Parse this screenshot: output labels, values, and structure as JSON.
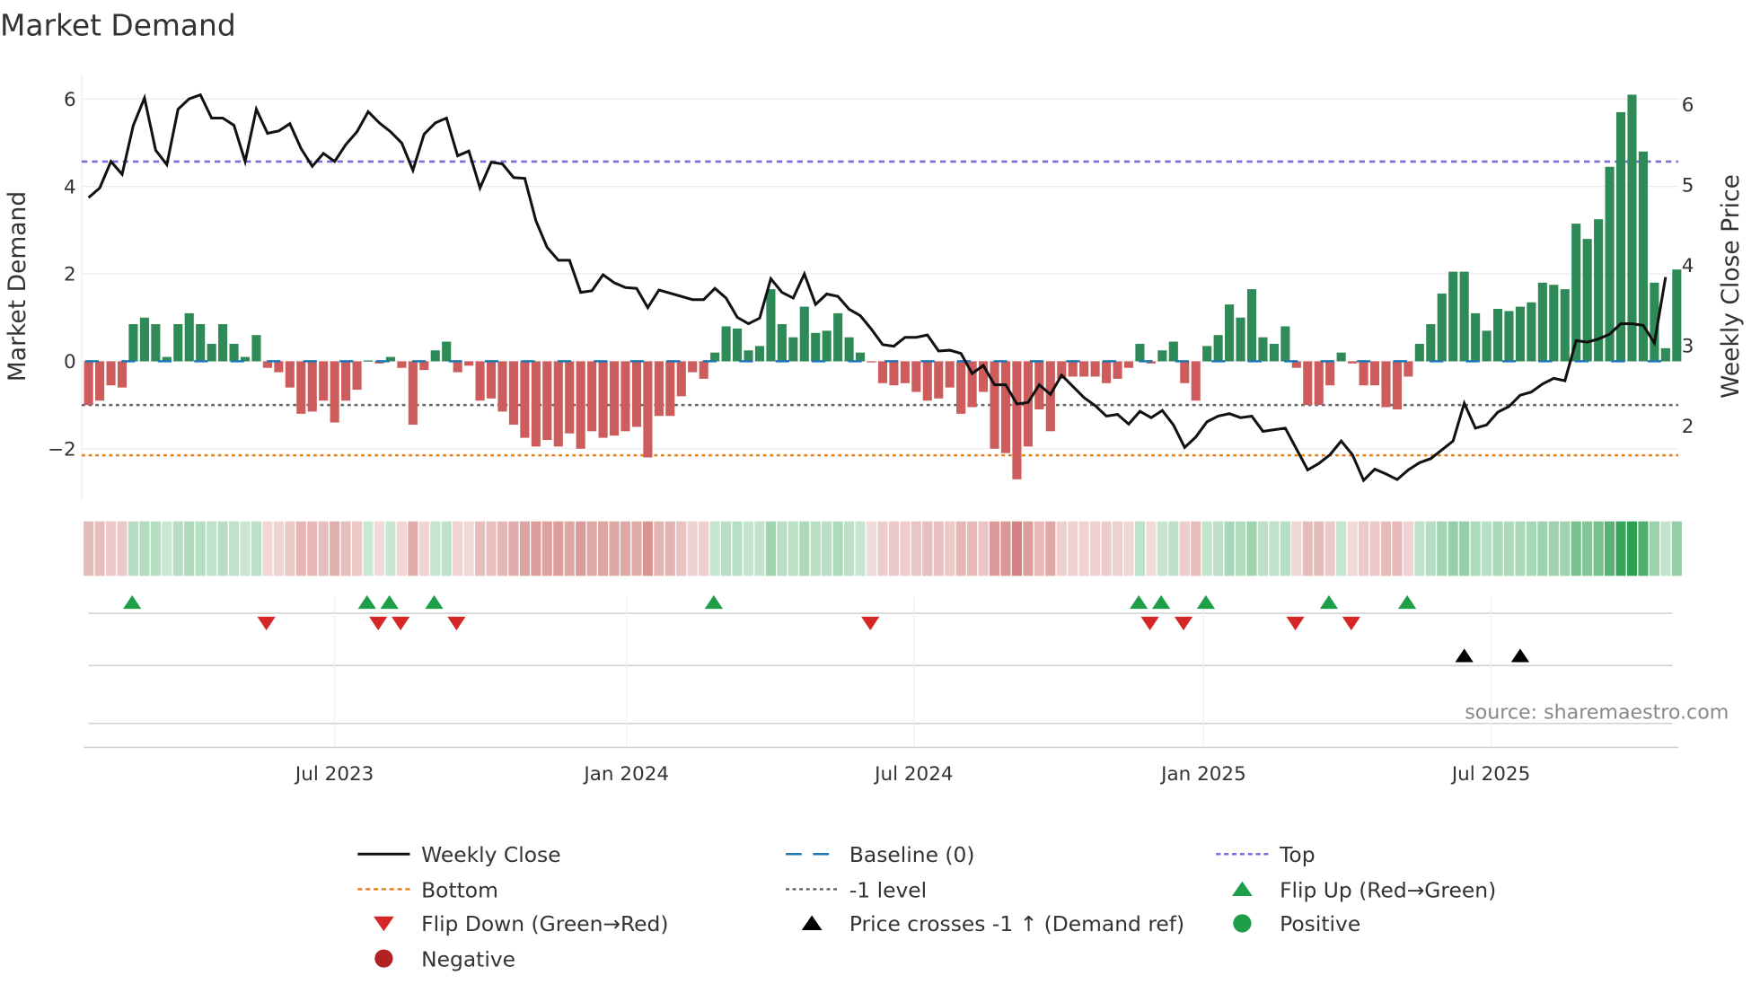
{
  "title": "Market Demand",
  "source": "source: sharemaestro.com",
  "colors": {
    "positive": "#2e8b57",
    "negative": "#cd5c5c",
    "price": "#111111",
    "baseline": "#1f77b4",
    "top": "#7b6fd6",
    "bottom": "#e6821e",
    "minus1": "#666666",
    "flip_up": "#1e9e48",
    "flip_down": "#d62728",
    "cross": "#000000",
    "neg_dot": "#b22222"
  },
  "chart_data": {
    "type": "bar+line",
    "title": "Market Demand",
    "ylabel": "Market Demand",
    "y2label": "Weekly Close Price",
    "ylim": [
      -3.2,
      6.6
    ],
    "y2lim": [
      1.1,
      6.3
    ],
    "yticks": [
      {
        "v": 6,
        "label": "6"
      },
      {
        "v": 4,
        "label": "4"
      },
      {
        "v": 2,
        "label": "2"
      },
      {
        "v": 0,
        "label": "0"
      },
      {
        "v": -2,
        "label": "−2"
      }
    ],
    "y2ticks": [
      {
        "v": 6,
        "label": "6"
      },
      {
        "v": 5,
        "label": "5"
      },
      {
        "v": 4,
        "label": "4"
      },
      {
        "v": 3,
        "label": "3"
      },
      {
        "v": 2,
        "label": "2"
      }
    ],
    "x_unit": "week index",
    "xticks": [
      {
        "i": 22,
        "label": "Jul 2023"
      },
      {
        "i": 48.1,
        "label": "Jan 2024"
      },
      {
        "i": 73.8,
        "label": "Jul 2024"
      },
      {
        "i": 99.7,
        "label": "Jan 2025"
      },
      {
        "i": 125.4,
        "label": "Jul 2025"
      }
    ],
    "levels": {
      "top": 4.57,
      "bottom": -2.15,
      "minus1": -1.0,
      "baseline": 0
    },
    "demand": [
      -1.0,
      -0.9,
      -0.55,
      -0.6,
      0.85,
      1.0,
      0.85,
      0.1,
      0.85,
      1.1,
      0.85,
      0.4,
      0.85,
      0.4,
      0.1,
      0.6,
      -0.15,
      -0.25,
      -0.6,
      -1.2,
      -1.15,
      -0.9,
      -1.4,
      -0.9,
      -0.65,
      0.02,
      -0.05,
      0.1,
      -0.15,
      -1.45,
      -0.2,
      0.25,
      0.45,
      -0.25,
      -0.1,
      -0.9,
      -0.85,
      -1.15,
      -1.45,
      -1.75,
      -1.95,
      -1.8,
      -1.95,
      -1.65,
      -2.0,
      -1.6,
      -1.75,
      -1.7,
      -1.6,
      -1.5,
      -2.2,
      -1.25,
      -1.25,
      -0.8,
      -0.25,
      -0.4,
      0.2,
      0.8,
      0.75,
      0.25,
      0.35,
      1.65,
      0.85,
      0.55,
      1.25,
      0.65,
      0.7,
      1.1,
      0.55,
      0.2,
      -0.02,
      -0.5,
      -0.55,
      -0.5,
      -0.7,
      -0.9,
      -0.85,
      -0.6,
      -1.2,
      -1.05,
      -0.7,
      -2.0,
      -2.1,
      -2.7,
      -1.95,
      -1.1,
      -1.6,
      -0.4,
      -0.35,
      -0.35,
      -0.35,
      -0.5,
      -0.4,
      -0.15,
      0.4,
      -0.05,
      0.25,
      0.45,
      -0.5,
      -0.9,
      0.35,
      0.6,
      1.3,
      1.0,
      1.65,
      0.55,
      0.4,
      0.8,
      -0.15,
      -1.0,
      -1.0,
      -0.55,
      0.2,
      -0.05,
      -0.55,
      -0.55,
      -1.05,
      -1.1,
      -0.35,
      0.4,
      0.85,
      1.55,
      2.05,
      2.05,
      1.1,
      0.7,
      1.2,
      1.15,
      1.25,
      1.35,
      1.8,
      1.75,
      1.65,
      3.15,
      2.8,
      3.25,
      4.45,
      5.7,
      6.1,
      4.8,
      1.8,
      0.3,
      2.1
    ],
    "close": [
      4.84,
      4.96,
      5.29,
      5.13,
      5.74,
      6.08,
      5.43,
      5.25,
      5.94,
      6.07,
      6.12,
      5.83,
      5.83,
      5.74,
      5.29,
      5.94,
      5.64,
      5.67,
      5.76,
      5.45,
      5.23,
      5.39,
      5.29,
      5.5,
      5.66,
      5.91,
      5.77,
      5.66,
      5.52,
      5.18,
      5.63,
      5.77,
      5.83,
      5.36,
      5.42,
      4.96,
      5.28,
      5.26,
      5.09,
      5.08,
      4.55,
      4.22,
      4.06,
      4.06,
      3.66,
      3.68,
      3.88,
      3.78,
      3.72,
      3.71,
      3.47,
      3.69,
      3.65,
      3.61,
      3.57,
      3.57,
      3.71,
      3.59,
      3.35,
      3.27,
      3.34,
      3.83,
      3.66,
      3.59,
      3.89,
      3.51,
      3.64,
      3.61,
      3.45,
      3.37,
      3.2,
      3.01,
      2.99,
      3.1,
      3.1,
      3.13,
      2.93,
      2.94,
      2.9,
      2.65,
      2.75,
      2.51,
      2.51,
      2.27,
      2.29,
      2.51,
      2.39,
      2.63,
      2.49,
      2.35,
      2.25,
      2.12,
      2.14,
      2.02,
      2.18,
      2.1,
      2.19,
      2.01,
      1.73,
      1.86,
      2.05,
      2.12,
      2.15,
      2.1,
      2.12,
      1.93,
      1.95,
      1.97,
      1.71,
      1.45,
      1.53,
      1.64,
      1.81,
      1.64,
      1.32,
      1.46,
      1.4,
      1.33,
      1.45,
      1.54,
      1.59,
      1.7,
      1.81,
      2.28,
      1.97,
      2.01,
      2.17,
      2.24,
      2.38,
      2.42,
      2.52,
      2.59,
      2.56,
      3.06,
      3.04,
      3.08,
      3.14,
      3.27,
      3.27,
      3.25,
      3.03,
      3.85
    ],
    "flip_up": [
      4,
      25,
      27,
      31,
      56,
      94,
      96,
      100,
      111,
      118
    ],
    "flip_down": [
      16,
      26,
      28,
      33,
      70,
      95,
      98,
      108,
      113
    ],
    "price_crosses": [
      123,
      128
    ]
  },
  "legend": [
    {
      "key": "weekly_close",
      "label": "Weekly Close"
    },
    {
      "key": "baseline",
      "label": "Baseline (0)"
    },
    {
      "key": "top",
      "label": "Top"
    },
    {
      "key": "bottom",
      "label": "Bottom"
    },
    {
      "key": "minus1",
      "label": "-1 level"
    },
    {
      "key": "flip_up",
      "label": "Flip Up (Red→Green)"
    },
    {
      "key": "flip_down",
      "label": "Flip Down (Green→Red)"
    },
    {
      "key": "cross",
      "label": "Price crosses -1 ↑ (Demand ref)"
    },
    {
      "key": "positive",
      "label": "Positive"
    },
    {
      "key": "negative",
      "label": "Negative"
    }
  ]
}
